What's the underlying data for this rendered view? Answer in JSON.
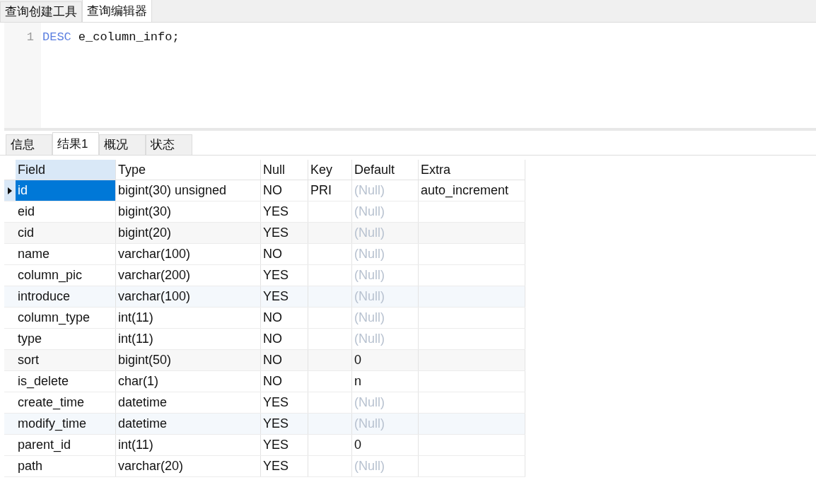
{
  "top_tabs": [
    {
      "label": "查询创建工具",
      "selected": false
    },
    {
      "label": "查询编辑器",
      "selected": true
    }
  ],
  "editor": {
    "lines": [
      {
        "number": "1",
        "keyword": "DESC",
        "rest": "e_column_info;"
      }
    ]
  },
  "result_tabs": [
    {
      "label": "信息",
      "selected": false
    },
    {
      "label": "结果1",
      "selected": true
    },
    {
      "label": "概况",
      "selected": false
    },
    {
      "label": "状态",
      "selected": false
    }
  ],
  "table": {
    "columns": [
      "Field",
      "Type",
      "Null",
      "Key",
      "Default",
      "Extra"
    ],
    "rows": [
      {
        "selected": true,
        "cells": [
          "id",
          "bigint(30) unsigned",
          "NO",
          "PRI",
          "(Null)",
          "auto_increment"
        ],
        "default_is_null": true
      },
      {
        "selected": false,
        "cells": [
          "eid",
          "bigint(30)",
          "YES",
          "",
          "(Null)",
          ""
        ],
        "default_is_null": true
      },
      {
        "selected": false,
        "cells": [
          "cid",
          "bigint(20)",
          "YES",
          "",
          "(Null)",
          ""
        ],
        "default_is_null": true
      },
      {
        "selected": false,
        "cells": [
          "name",
          "varchar(100)",
          "NO",
          "",
          "(Null)",
          ""
        ],
        "default_is_null": true
      },
      {
        "selected": false,
        "cells": [
          "column_pic",
          "varchar(200)",
          "YES",
          "",
          "(Null)",
          ""
        ],
        "default_is_null": true
      },
      {
        "selected": false,
        "cells": [
          "introduce",
          "varchar(100)",
          "YES",
          "",
          "(Null)",
          ""
        ],
        "default_is_null": true
      },
      {
        "selected": false,
        "cells": [
          "column_type",
          "int(11)",
          "NO",
          "",
          "(Null)",
          ""
        ],
        "default_is_null": true
      },
      {
        "selected": false,
        "cells": [
          "type",
          "int(11)",
          "NO",
          "",
          "(Null)",
          ""
        ],
        "default_is_null": true
      },
      {
        "selected": false,
        "cells": [
          "sort",
          "bigint(50)",
          "NO",
          "",
          "0",
          ""
        ],
        "default_is_null": false
      },
      {
        "selected": false,
        "cells": [
          "is_delete",
          "char(1)",
          "NO",
          "",
          "n",
          ""
        ],
        "default_is_null": false
      },
      {
        "selected": false,
        "cells": [
          "create_time",
          "datetime",
          "YES",
          "",
          "(Null)",
          ""
        ],
        "default_is_null": true
      },
      {
        "selected": false,
        "cells": [
          "modify_time",
          "datetime",
          "YES",
          "",
          "(Null)",
          ""
        ],
        "default_is_null": true
      },
      {
        "selected": false,
        "cells": [
          "parent_id",
          "int(11)",
          "YES",
          "",
          "0",
          ""
        ],
        "default_is_null": false
      },
      {
        "selected": false,
        "cells": [
          "path",
          "varchar(20)",
          "YES",
          "",
          "(Null)",
          ""
        ],
        "default_is_null": true
      }
    ]
  }
}
